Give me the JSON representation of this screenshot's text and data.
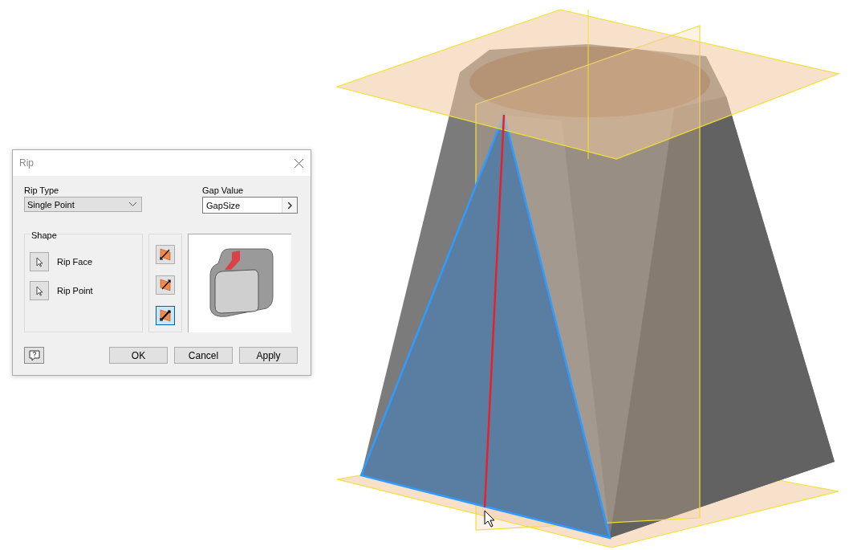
{
  "dialog": {
    "title": "Rip",
    "rip_type": {
      "label": "Rip Type",
      "value": "Single Point"
    },
    "gap_value": {
      "label": "Gap Value",
      "value": "GapSize"
    },
    "shape": {
      "label": "Shape",
      "selectors": [
        {
          "label": "Rip Face"
        },
        {
          "label": "Rip Point"
        }
      ]
    },
    "direction_buttons": [
      {
        "selected": false
      },
      {
        "selected": false
      },
      {
        "selected": true
      }
    ],
    "buttons": [
      "OK",
      "Cancel",
      "Apply"
    ]
  }
}
